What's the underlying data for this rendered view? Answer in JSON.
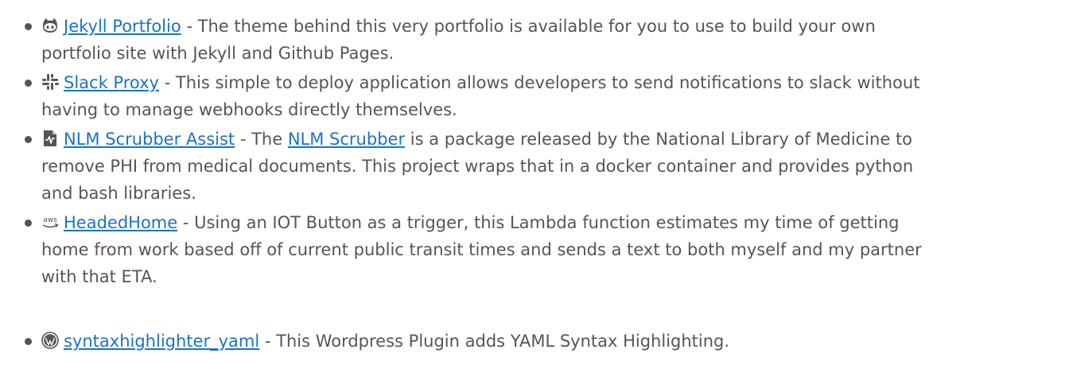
{
  "colors": {
    "text": "#555555",
    "link": "#1a73c8",
    "background": "#ffffff"
  },
  "projects": [
    {
      "icon": "github-icon",
      "link": "Jekyll Portfolio",
      "line1": " - The theme behind this very portfolio is available for you to use to build your own",
      "line2": "portfolio site with Jekyll and Github Pages."
    },
    {
      "icon": "slack-icon",
      "link": "Slack Proxy",
      "line1": " - This simple to deploy application allows developers to send notifications to slack without",
      "line2": "having to manage webhooks directly themselves."
    },
    {
      "icon": "medical-file-icon",
      "link": "NLM Scrubber Assist",
      "line1a": " - The ",
      "inline_link": "NLM Scrubber",
      "line1b": " is a package released by the National Library of Medicine to",
      "line2": "remove PHI from medical documents. This project wraps that in a docker container and provides python",
      "line3": "and bash libraries."
    },
    {
      "icon": "aws-icon",
      "icon_text": "aws",
      "link": "HeadedHome",
      "line1": " - Using an IOT Button as a trigger, this Lambda function estimates my time of getting",
      "line2": "home from work based off of current public transit times and sends a text to both myself and my partner",
      "line3": "with that ETA."
    },
    {
      "icon": "wordpress-icon",
      "link": "syntaxhighlighter_yaml",
      "line1": " - This Wordpress Plugin adds YAML Syntax Highlighting."
    }
  ]
}
